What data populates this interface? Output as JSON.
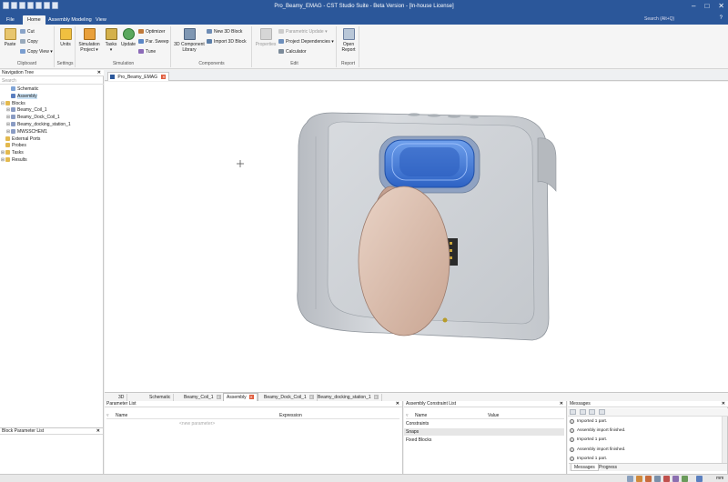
{
  "window": {
    "title": "Pro_Beamy_EMAG - CST Studio Suite - Beta Version - [In-house License]",
    "controls": [
      "help-icon",
      "minimize-icon",
      "maximize-icon",
      "close-icon"
    ]
  },
  "menu": {
    "tabs": [
      "File",
      "Home",
      "Assembly Modeling",
      "View"
    ],
    "active": "Home",
    "search_placeholder": "Search (Alt+Q)",
    "help": "?"
  },
  "ribbon": {
    "clipboard": {
      "label": "Clipboard",
      "paste": "Paste",
      "cut": "Cut",
      "copy": "Copy",
      "copy_view": "Copy View"
    },
    "settings": {
      "label": "Settings",
      "units": "Units"
    },
    "simulation": {
      "label": "Simulation",
      "simulation_project": "Simulation Project",
      "tasks": "Tasks",
      "update": "Update",
      "optimizer": "Optimizer",
      "par_sweep": "Par. Sweep",
      "tune": "Tune"
    },
    "components": {
      "label": "Components",
      "library": "3D Component Library",
      "new_block": "New 3D Block",
      "import_block": "Import 3D Block"
    },
    "edit": {
      "label": "Edit",
      "properties": "Properties",
      "parametric_update": "Parametric Update",
      "project_dependencies": "Project Dependencies",
      "calculator": "Calculator"
    },
    "report": {
      "label": "Report",
      "open_report": "Open Report"
    }
  },
  "navigation": {
    "title": "Navigation Tree",
    "search_placeholder": "Search",
    "items": [
      {
        "label": "Schematic",
        "level": 1
      },
      {
        "label": "Assembly",
        "level": 1,
        "selected": true
      },
      {
        "label": "Blocks",
        "level": 0,
        "expanded": true
      },
      {
        "label": "Beamy_Coil_1",
        "level": 1
      },
      {
        "label": "Beamy_Dock_Coil_1",
        "level": 1
      },
      {
        "label": "Beamy_docking_station_1",
        "level": 1
      },
      {
        "label": "MWSSCHEM1",
        "level": 1
      },
      {
        "label": "External Ports",
        "level": 0
      },
      {
        "label": "Probes",
        "level": 0
      },
      {
        "label": "Tasks",
        "level": 0
      },
      {
        "label": "Results",
        "level": 0
      }
    ]
  },
  "block_parameter_list": {
    "title": "Block Parameter List"
  },
  "document_tab": {
    "label": "Pro_Beamy_EMAG"
  },
  "view_tabs": [
    {
      "label": "3D",
      "close": false
    },
    {
      "label": "Schematic",
      "close": false
    },
    {
      "label": "Beamy_Coil_1",
      "close": true
    },
    {
      "label": "Assembly",
      "close": true,
      "active": true
    },
    {
      "label": "Beamy_Dock_Coil_1",
      "close": true
    },
    {
      "label": "Beamy_docking_station_1",
      "close": true
    }
  ],
  "parameter_list": {
    "title": "Parameter List",
    "columns": [
      "Name",
      "Expression"
    ],
    "new_placeholder": "<new parameter>"
  },
  "assembly_constraint_list": {
    "title": "Assembly Constraint List",
    "columns": [
      "Name",
      "Value"
    ],
    "rows": [
      "Constraints",
      "Snaps",
      "Fixed Blocks"
    ]
  },
  "messages": {
    "title": "Messages",
    "items": [
      "Imported 1 part.",
      "Assembly import finished.",
      "Imported 1 part.",
      "Assembly import finished.",
      "Imported 1 part."
    ],
    "tabs": [
      "Messages",
      "Progress"
    ]
  },
  "status": {
    "units": "mm"
  },
  "colors": {
    "title_bar": "#2b579a",
    "selection": "#cce4f7",
    "close_badge": "#e05b3c",
    "model_body": "#c9ccd1",
    "coil_copper": "#d8b9a8",
    "coil_blue": "#3d78d8"
  }
}
